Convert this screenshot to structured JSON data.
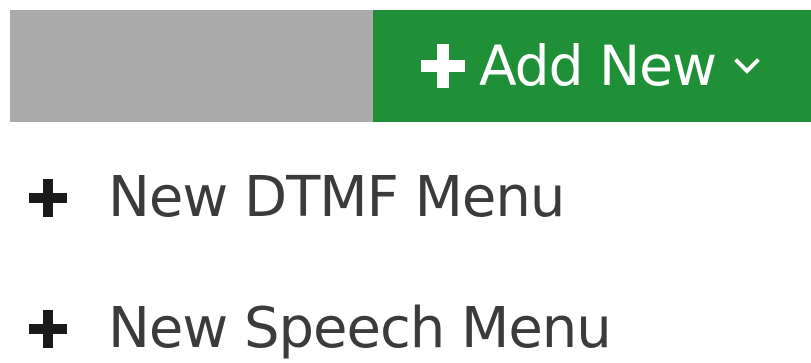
{
  "toolbar": {
    "add_new_label": "Add New",
    "colors": {
      "gray_block": "#ababab",
      "green": "#1f8f38",
      "text_white": "#ffffff"
    },
    "icons": {
      "plus": "plus-icon",
      "chevron": "chevron-down-icon"
    }
  },
  "dropdown": {
    "items": [
      {
        "label": "New DTMF Menu",
        "icon": "plus-icon"
      },
      {
        "label": "New Speech Menu",
        "icon": "plus-icon"
      }
    ],
    "text_color": "#3b3b3b"
  }
}
